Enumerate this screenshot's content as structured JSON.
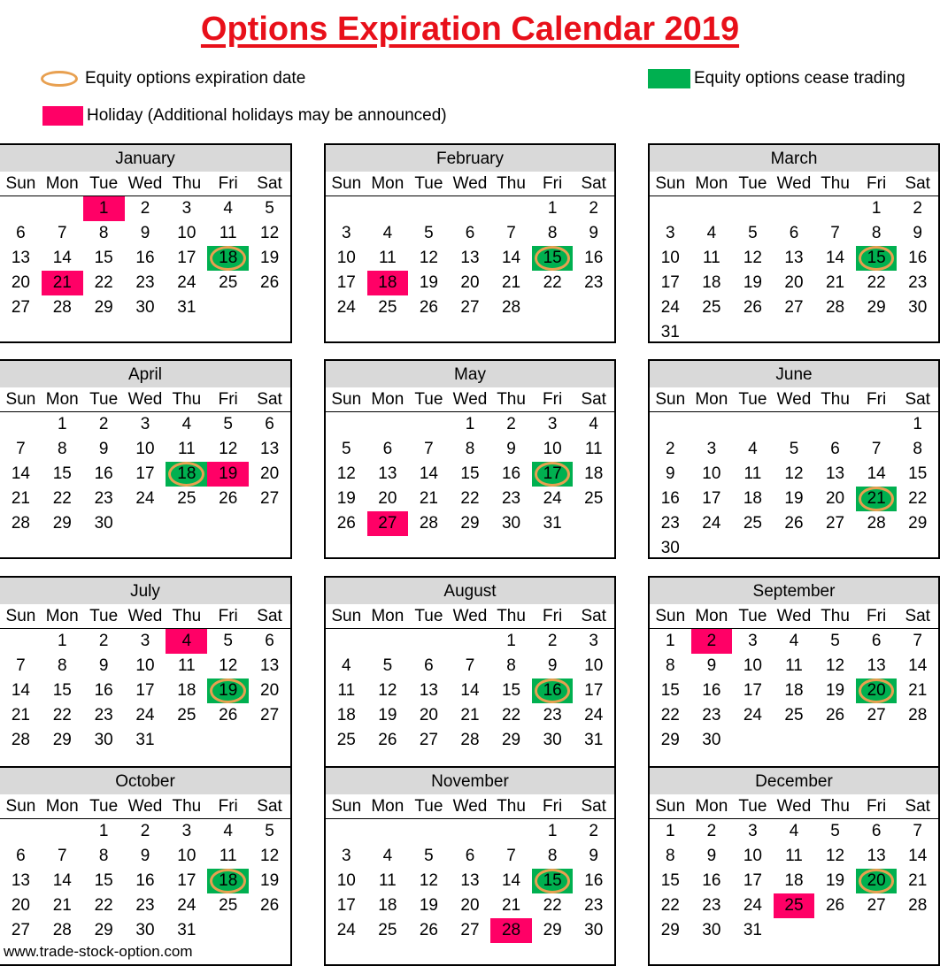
{
  "title": "Options Expiration Calendar 2019",
  "legend": {
    "expiration": "Equity options expiration date",
    "cease": "Equity options cease trading",
    "holiday": "Holiday (Additional holidays may be announced)"
  },
  "colors": {
    "title": "#e8101a",
    "holiday": "#ff0066",
    "cease": "#00b050",
    "expiration_ring": "#e8a050",
    "header_bg": "#d9d9d9"
  },
  "weekdays": [
    "Sun",
    "Mon",
    "Tue",
    "Wed",
    "Thu",
    "Fri",
    "Sat"
  ],
  "months": [
    {
      "name": "January",
      "start": 2,
      "days": 31,
      "holidays": [
        1,
        21
      ],
      "cease": [
        18
      ],
      "expiration": [
        18
      ]
    },
    {
      "name": "February",
      "start": 5,
      "days": 28,
      "holidays": [
        18
      ],
      "cease": [
        15
      ],
      "expiration": [
        15
      ]
    },
    {
      "name": "March",
      "start": 5,
      "days": 31,
      "holidays": [],
      "cease": [
        15
      ],
      "expiration": [
        15
      ]
    },
    {
      "name": "April",
      "start": 1,
      "days": 30,
      "holidays": [
        19
      ],
      "cease": [
        18
      ],
      "expiration": [
        18
      ]
    },
    {
      "name": "May",
      "start": 3,
      "days": 31,
      "holidays": [
        27
      ],
      "cease": [
        17
      ],
      "expiration": [
        17
      ]
    },
    {
      "name": "June",
      "start": 6,
      "days": 30,
      "holidays": [],
      "cease": [
        21
      ],
      "expiration": [
        21
      ]
    },
    {
      "name": "July",
      "start": 1,
      "days": 31,
      "holidays": [
        4
      ],
      "cease": [
        19
      ],
      "expiration": [
        19
      ]
    },
    {
      "name": "August",
      "start": 4,
      "days": 31,
      "holidays": [],
      "cease": [
        16
      ],
      "expiration": [
        16
      ]
    },
    {
      "name": "September",
      "start": 0,
      "days": 30,
      "holidays": [
        2
      ],
      "cease": [
        20
      ],
      "expiration": [
        20
      ]
    },
    {
      "name": "October",
      "start": 2,
      "days": 31,
      "holidays": [],
      "cease": [
        18
      ],
      "expiration": [
        18
      ]
    },
    {
      "name": "November",
      "start": 5,
      "days": 30,
      "holidays": [
        28
      ],
      "cease": [
        15
      ],
      "expiration": [
        15
      ]
    },
    {
      "name": "December",
      "start": 0,
      "days": 31,
      "holidays": [
        25
      ],
      "cease": [
        20
      ],
      "expiration": [
        20
      ]
    }
  ],
  "footer": "www.trade-stock-option.com"
}
